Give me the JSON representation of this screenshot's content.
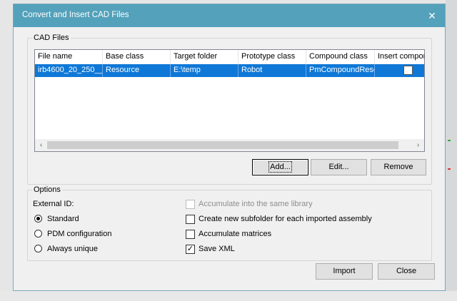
{
  "dialog": {
    "title": "Convert and Insert CAD Files",
    "close_glyph": "✕"
  },
  "cad_files": {
    "group_label": "CAD Files",
    "columns": [
      "File name",
      "Base class",
      "Target folder",
      "Prototype class",
      "Compound class",
      "Insert compor"
    ],
    "rows": [
      {
        "file_name": "irb4600_20_250__",
        "base_class": "Resource",
        "target_folder": "E:\\temp",
        "prototype_class": "Robot",
        "compound_class": "PmCompoundResc",
        "insert_component": false,
        "selected": true
      }
    ],
    "scroll_left": "‹",
    "scroll_right": "›",
    "buttons": {
      "add": "Add...",
      "edit": "Edit...",
      "remove": "Remove"
    }
  },
  "options": {
    "group_label": "Options",
    "external_id_label": "External ID:",
    "external_id_options": [
      "Standard",
      "PDM configuration",
      "Always unique"
    ],
    "external_id_selected": "Standard",
    "checkboxes": [
      {
        "label": "Accumulate into the same library",
        "checked": false,
        "enabled": false
      },
      {
        "label": "Create new subfolder for each imported assembly",
        "checked": false,
        "enabled": true
      },
      {
        "label": "Accumulate matrices",
        "checked": false,
        "enabled": true
      },
      {
        "label": "Save XML",
        "checked": true,
        "enabled": true
      }
    ],
    "check_glyph": "✓"
  },
  "footer": {
    "import": "Import",
    "close": "Close"
  },
  "colors": {
    "titlebar": "#53a1ba",
    "selection": "#0f78d7",
    "dialog_bg": "#f0f0f0"
  }
}
